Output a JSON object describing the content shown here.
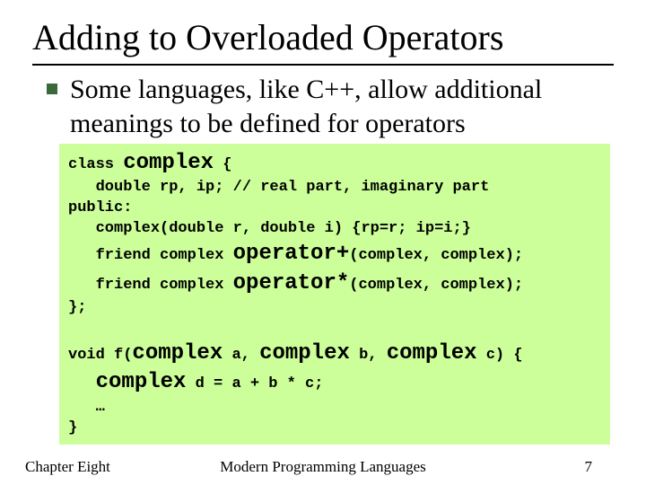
{
  "title": "Adding to Overloaded Operators",
  "bullet": "Some languages, like C++, allow additional meanings to be defined for operators",
  "code": {
    "l1a": "class ",
    "l1b": "complex",
    "l1c": " {",
    "l2": "   double rp, ip; // real part, imaginary part",
    "l3": "public:",
    "l4": "   complex(double r, double i) {rp=r; ip=i;}",
    "l5a": "   friend complex ",
    "l5b": "operator+",
    "l5c": "(complex, complex);",
    "l6a": "   friend complex ",
    "l6b": "operator*",
    "l6c": "(complex, complex);",
    "l7": "};",
    "blank": " ",
    "l8a": "void f(",
    "l8b": "complex",
    "l8c": " a, ",
    "l8d": "complex",
    "l8e": " b, ",
    "l8f": "complex",
    "l8g": " c) {",
    "l9a": "   ",
    "l9b": "complex",
    "l9c": " d = a + b * c;",
    "l10": "   …",
    "l11": "}"
  },
  "footer": {
    "left": "Chapter Eight",
    "center": "Modern Programming Languages",
    "right": "7"
  }
}
